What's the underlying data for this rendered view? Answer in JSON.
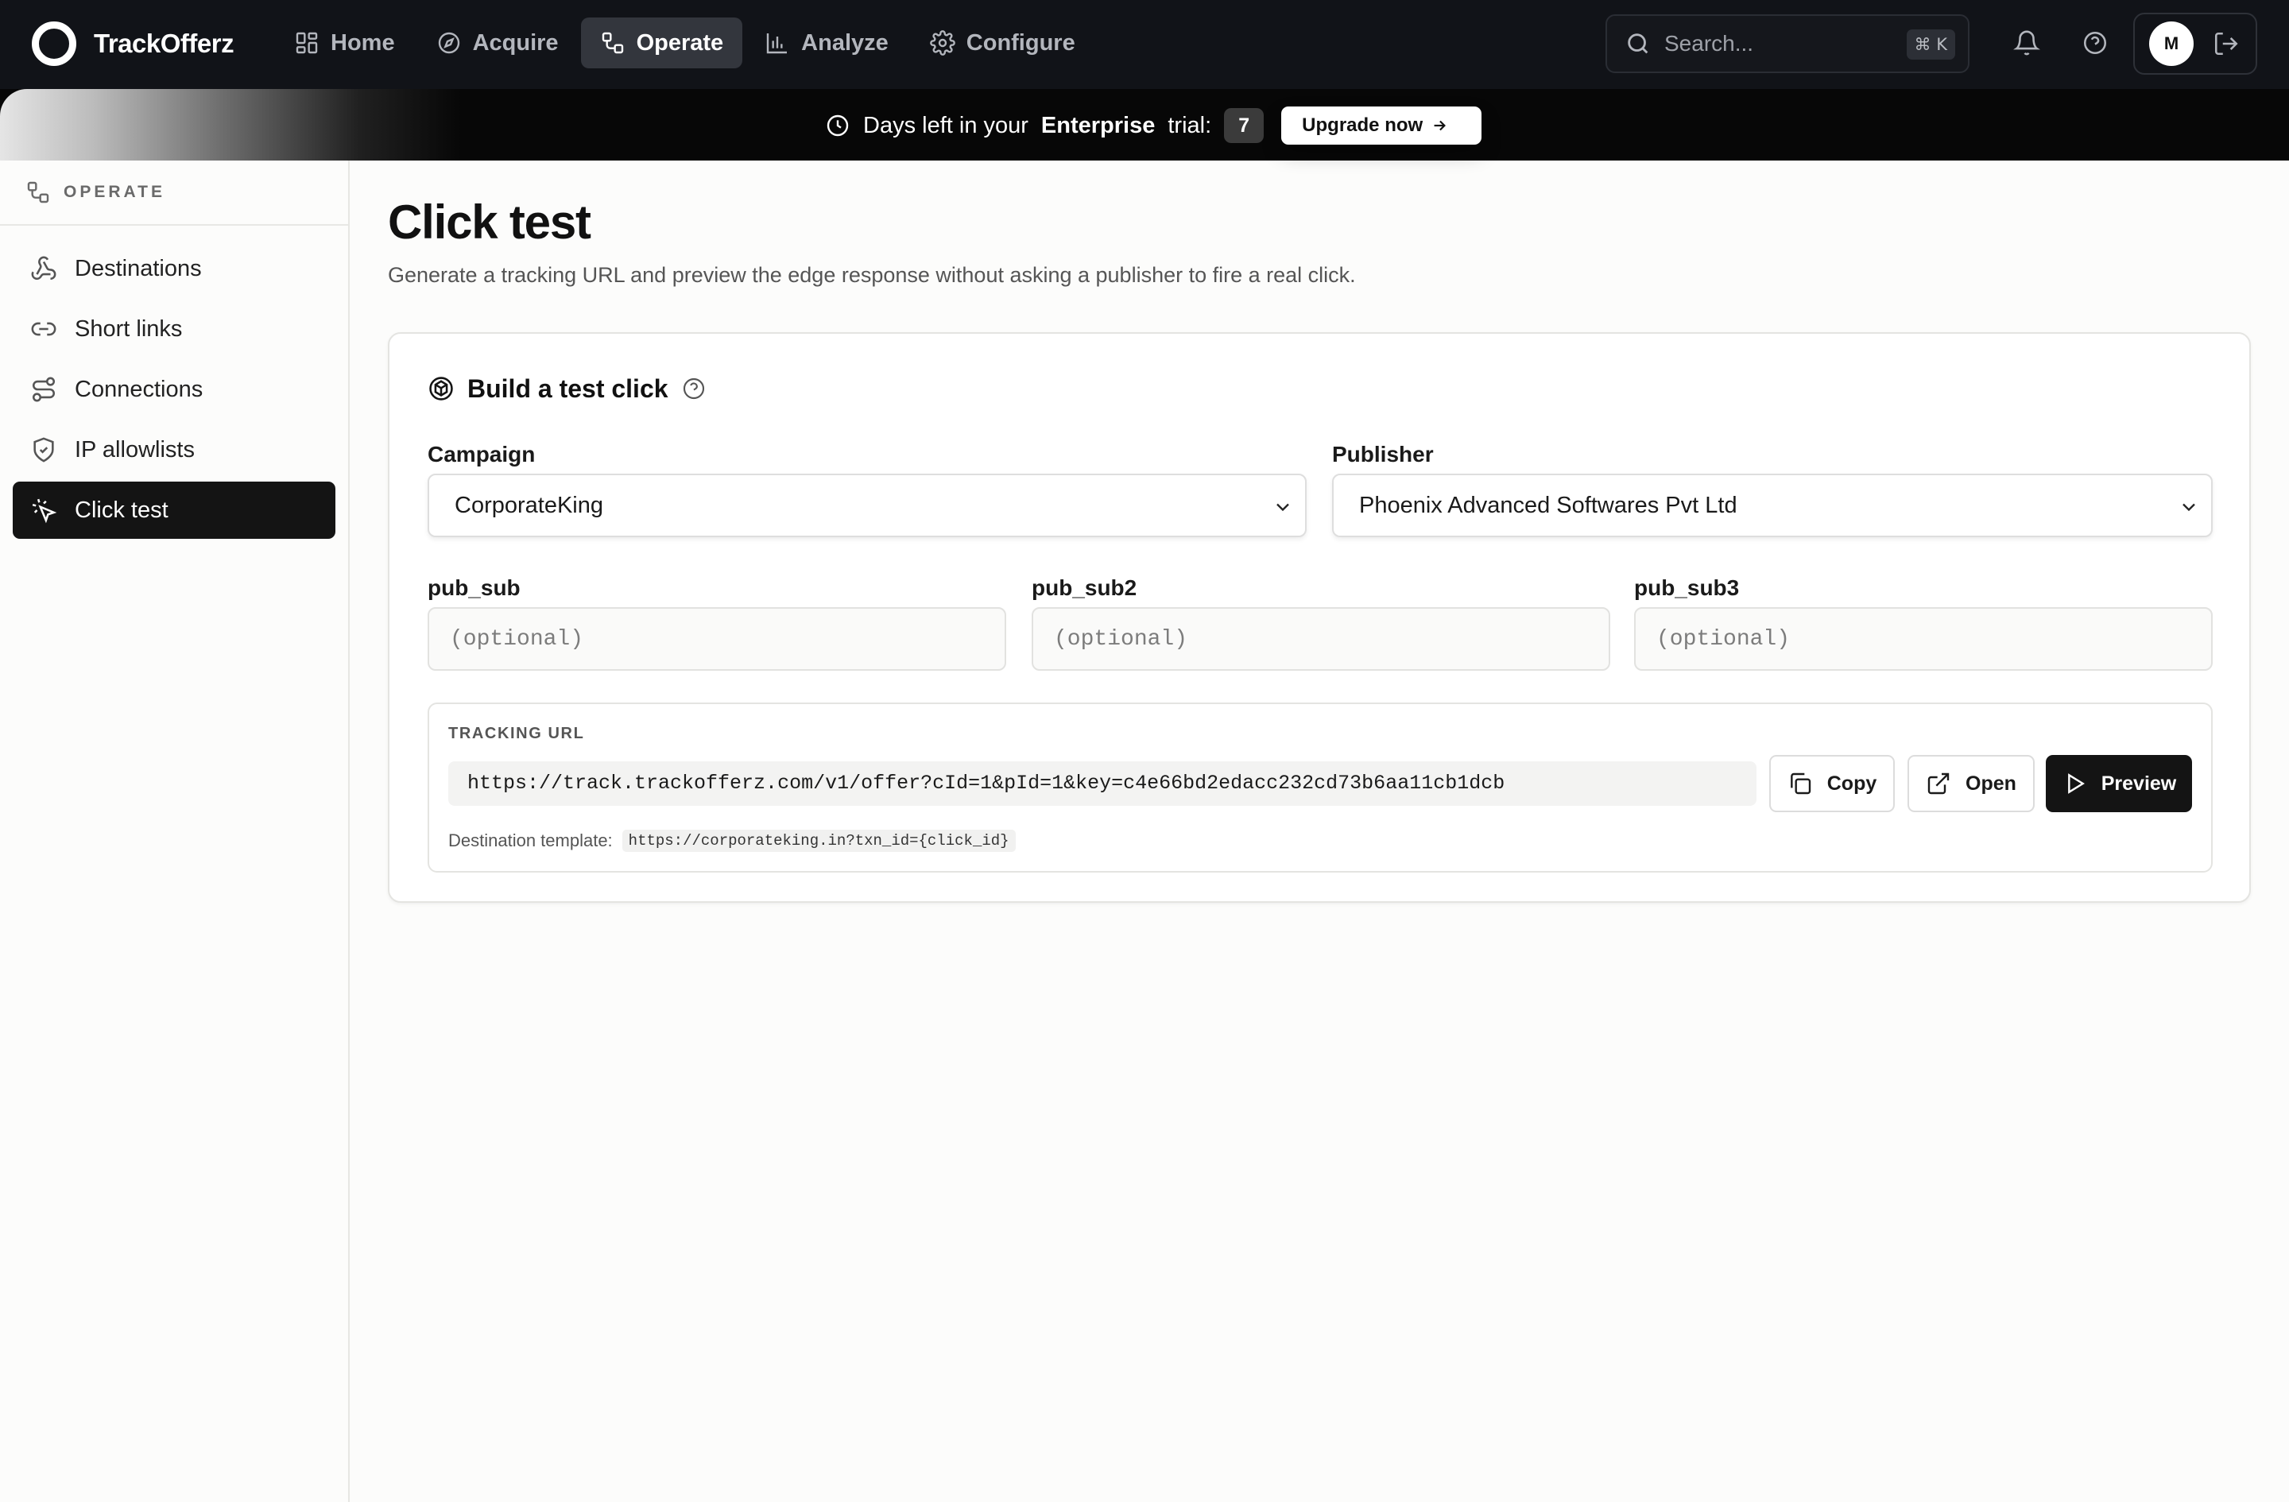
{
  "brand": {
    "name": "TrackOfferz"
  },
  "nav": {
    "items": [
      {
        "label": "Home",
        "icon": "dashboard-grid-icon",
        "active": false
      },
      {
        "label": "Acquire",
        "icon": "compass-icon",
        "active": false
      },
      {
        "label": "Operate",
        "icon": "workflow-icon",
        "active": true
      },
      {
        "label": "Analyze",
        "icon": "bar-chart-icon",
        "active": false
      },
      {
        "label": "Configure",
        "icon": "gear-icon",
        "active": false
      }
    ]
  },
  "search": {
    "placeholder": "Search...",
    "shortcut": "⌘ K"
  },
  "user": {
    "initial": "M"
  },
  "banner": {
    "prefix": "Days left in your",
    "plan": "Enterprise",
    "suffix": "trial:",
    "days": "7",
    "upgrade_label": "Upgrade now"
  },
  "sidebar": {
    "section": "OPERATE",
    "items": [
      {
        "label": "Destinations",
        "icon": "webhook-icon",
        "active": false
      },
      {
        "label": "Short links",
        "icon": "link-icon",
        "active": false
      },
      {
        "label": "Connections",
        "icon": "route-icon",
        "active": false
      },
      {
        "label": "IP allowlists",
        "icon": "shield-check-icon",
        "active": false
      },
      {
        "label": "Click test",
        "icon": "mouse-click-icon",
        "active": true
      }
    ]
  },
  "page": {
    "title": "Click test",
    "subtitle": "Generate a tracking URL and preview the edge response without asking a publisher to fire a real click."
  },
  "card": {
    "title": "Build a test click",
    "campaign": {
      "label": "Campaign",
      "value": "CorporateKing"
    },
    "publisher": {
      "label": "Publisher",
      "value": "Phoenix Advanced Softwares Pvt Ltd"
    },
    "pub_sub": {
      "label": "pub_sub",
      "placeholder": "(optional)"
    },
    "pub_sub2": {
      "label": "pub_sub2",
      "placeholder": "(optional)"
    },
    "pub_sub3": {
      "label": "pub_sub3",
      "placeholder": "(optional)"
    },
    "tracking": {
      "title": "TRACKING URL",
      "url": "https://track.trackofferz.com/v1/offer?cId=1&pId=1&key=c4e66bd2edacc232cd73b6aa11cb1dcb",
      "copy_label": "Copy",
      "open_label": "Open",
      "preview_label": "Preview",
      "dest_label": "Destination template:",
      "dest_value": "https://corporateking.in?txn_id={click_id}"
    }
  },
  "colors": {
    "topbar": "#111318",
    "banner": "#070707",
    "active_sidebar": "#141414",
    "page_bg": "#fcfcfb"
  }
}
